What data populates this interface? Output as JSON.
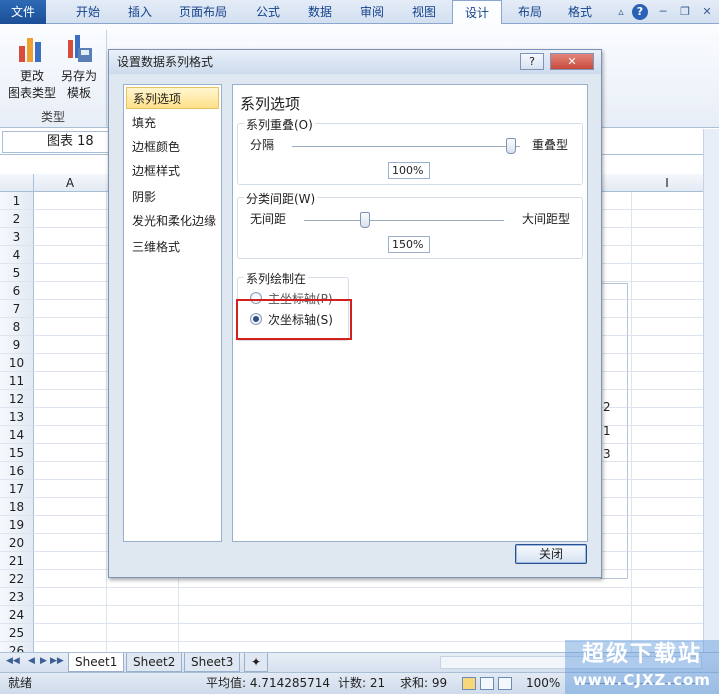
{
  "ribbon": {
    "tabs": [
      "文件",
      "开始",
      "插入",
      "页面布局",
      "公式",
      "数据",
      "审阅",
      "视图",
      "设计",
      "布局",
      "格式"
    ],
    "active_tab": "设计",
    "buttons": {
      "change_type": [
        "更改",
        "图表类型"
      ],
      "save_template": [
        "另存为",
        "模板"
      ]
    },
    "group_label": "类型",
    "icons": [
      "chevron-up-icon",
      "help-icon",
      "minimize-icon",
      "restore-icon",
      "close-icon"
    ]
  },
  "formula_bar": {
    "name_box": "图表 18"
  },
  "sheet": {
    "columns": [
      "A",
      "I"
    ],
    "rows": [
      "1",
      "2",
      "3",
      "4",
      "5",
      "6",
      "7",
      "8",
      "9",
      "10",
      "11",
      "12",
      "13",
      "14",
      "15",
      "16",
      "17",
      "18",
      "19",
      "20",
      "21",
      "22",
      "23",
      "24",
      "25",
      "26"
    ],
    "chart_legend_numbers": [
      "2",
      "1",
      "3"
    ]
  },
  "sheet_tabs": [
    "Sheet1",
    "Sheet2",
    "Sheet3"
  ],
  "status": {
    "mode": "就绪",
    "average_label": "平均值: 4.714285714",
    "count_label": "计数: 21",
    "sum_label": "求和: 99",
    "zoom": "100%"
  },
  "watermark": {
    "line1": "超级下载站",
    "line2": "www.CJXZ.com"
  },
  "dialog": {
    "title": "设置数据系列格式",
    "help_button": "?",
    "close_icon": "✕",
    "nav_items": [
      "系列选项",
      "填充",
      "边框颜色",
      "边框样式",
      "阴影",
      "发光和柔化边缘",
      "三维格式"
    ],
    "selected_nav": "系列选项",
    "content_title": "系列选项",
    "overlap": {
      "legend": "系列重叠(O)",
      "left_label": "分隔",
      "right_label": "重叠型",
      "value": "100%",
      "level": 1.0
    },
    "gap": {
      "legend": "分类间距(W)",
      "left_label": "无间距",
      "right_label": "大间距型",
      "value": "150%",
      "level": 0.3
    },
    "plot_on": {
      "legend": "系列绘制在",
      "primary": "主坐标轴(P)",
      "secondary": "次坐标轴(S)",
      "selected": "secondary"
    },
    "close_button": "关闭"
  }
}
